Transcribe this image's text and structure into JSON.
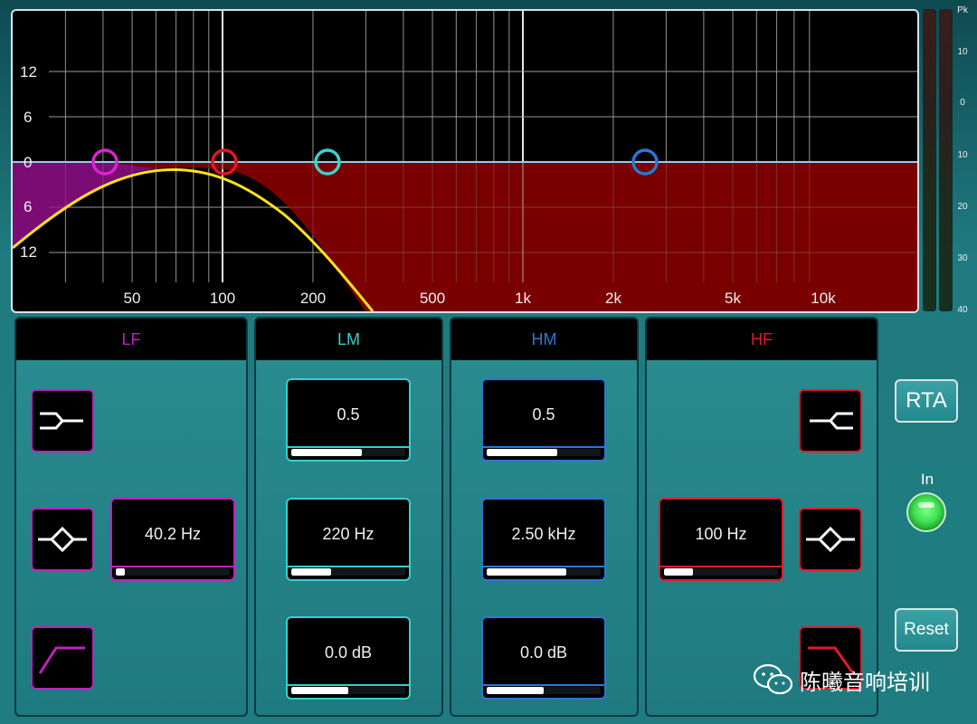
{
  "graph": {
    "y_labels": [
      "12",
      "6",
      "0",
      "6",
      "12"
    ],
    "x_labels": [
      "50",
      "100",
      "200",
      "500",
      "1k",
      "2k",
      "5k",
      "10k"
    ]
  },
  "meter": {
    "scale": [
      "Pk",
      "10",
      "0",
      "10",
      "20",
      "30",
      "40"
    ]
  },
  "bands": {
    "lf": {
      "title": "LF",
      "color": "#c21fbf",
      "freq": "40.2 Hz",
      "freq_fill": 0.08
    },
    "lm": {
      "title": "LM",
      "color": "#34d0d0",
      "q": "0.5",
      "q_fill": 0.62,
      "freq": "220 Hz",
      "freq_fill": 0.35,
      "gain": "0.0 dB",
      "gain_fill": 0.5
    },
    "hm": {
      "title": "HM",
      "color": "#2a77d6",
      "q": "0.5",
      "q_fill": 0.62,
      "freq": "2.50 kHz",
      "freq_fill": 0.7,
      "gain": "0.0 dB",
      "gain_fill": 0.5
    },
    "hf": {
      "title": "HF",
      "color": "#e2192a",
      "freq": "100 Hz",
      "freq_fill": 0.25
    }
  },
  "buttons": {
    "rta": "RTA",
    "in": "In",
    "reset": "Reset"
  },
  "watermark": {
    "text": "陈曦音响培训"
  }
}
